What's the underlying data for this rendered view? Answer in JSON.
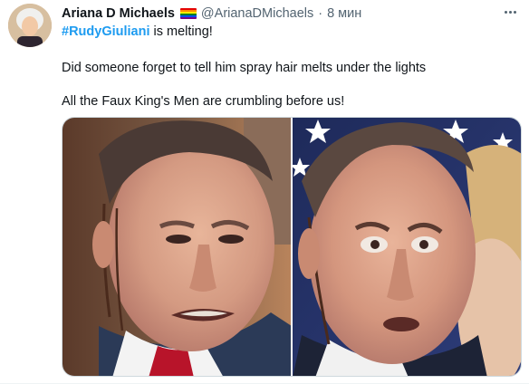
{
  "tweet": {
    "author_name": "Ariana D Michaels",
    "handle": "@ArianaDMichaels",
    "separator": "·",
    "time": "8 мин",
    "hashtag": "#RudyGiuliani",
    "line1_rest": " is melting!",
    "line2": "Did someone forget to tell him spray hair melts under the lights",
    "line3": "All the Faux King's Men are crumbling before us!"
  },
  "icons": {
    "avatar": "avatar",
    "flag": "rainbow-flag-icon",
    "more": "more-icon"
  },
  "colors": {
    "link": "#1d9bf0",
    "secondary_text": "#536471",
    "primary_text": "#0f1419",
    "border": "#cfd9de"
  }
}
